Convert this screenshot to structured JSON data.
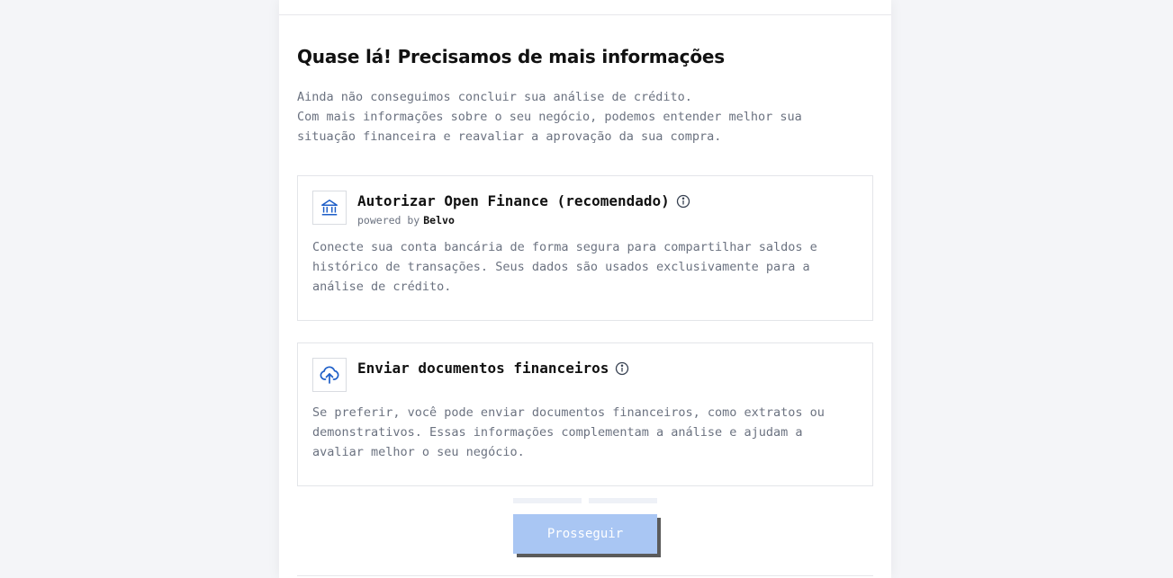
{
  "page": {
    "title": "Quase lá! Precisamos de mais informações",
    "intro_lines": [
      "Ainda não conseguimos concluir sua análise de crédito.",
      "Com mais informações sobre o seu negócio, podemos entender melhor sua",
      "situação financeira e reavaliar a aprovação da sua compra."
    ]
  },
  "options": {
    "open_finance": {
      "icon": "bank-icon",
      "title": "Autorizar Open Finance (recomendado)",
      "powered_by_label": "powered by",
      "powered_by_brand": "Belvo",
      "description_lines": [
        "Conecte sua conta bancária de forma segura para compartilhar saldos e",
        "histórico de transações. Seus dados são usados exclusivamente para a",
        "análise de crédito."
      ]
    },
    "documents": {
      "icon": "cloud-upload-icon",
      "title": "Enviar documentos financeiros",
      "description_lines": [
        "Se preferir, você pode enviar documentos financeiros, como extratos ou",
        "demonstrativos. Essas informações complementam a análise e ajudam a",
        "avaliar melhor o seu negócio."
      ]
    }
  },
  "actions": {
    "continue_label": "Prosseguir",
    "continue_disabled": true
  },
  "colors": {
    "accent": "#1d5ec8",
    "button_disabled": "#a9c6f3",
    "text_muted": "#6b7280",
    "page_bg": "#f4f5f8"
  }
}
